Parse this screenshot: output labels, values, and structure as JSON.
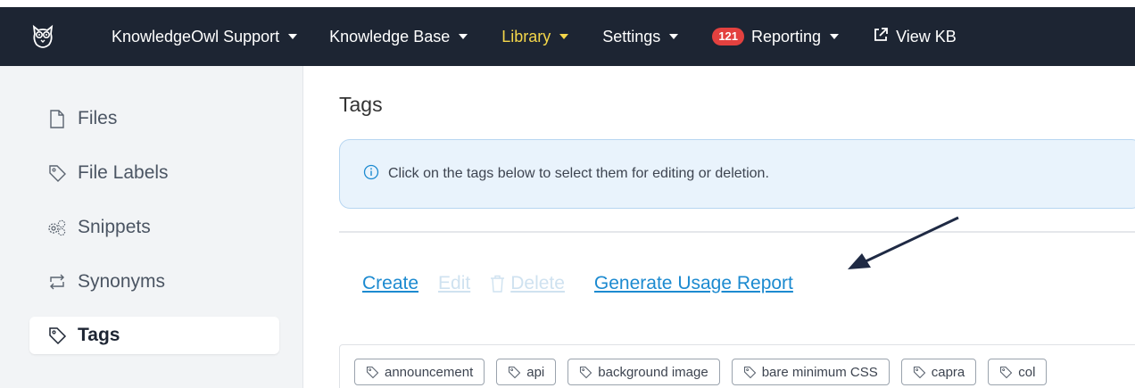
{
  "nav": {
    "logo_icon": "owl-logo-icon",
    "items": [
      {
        "label": "KnowledgeOwl Support",
        "caret": true
      },
      {
        "label": "Knowledge Base",
        "caret": true
      },
      {
        "label": "Library",
        "caret": true,
        "active": true
      },
      {
        "label": "Settings",
        "caret": true
      },
      {
        "label": "Reporting",
        "caret": true,
        "badge": "121"
      },
      {
        "label": "View KB",
        "icon": "external-link-icon"
      }
    ],
    "colors": {
      "background": "#1d2533",
      "active": "#f4d64a",
      "badge": "#e3413f"
    }
  },
  "sidebar": {
    "items": [
      {
        "label": "Files",
        "icon": "file-icon"
      },
      {
        "label": "File Labels",
        "icon": "tag-icon"
      },
      {
        "label": "Snippets",
        "icon": "gears-icon"
      },
      {
        "label": "Synonyms",
        "icon": "swap-arrows-icon"
      },
      {
        "label": "Tags",
        "icon": "tag-icon",
        "active": true
      }
    ]
  },
  "main": {
    "title": "Tags",
    "alert": {
      "icon": "info-icon",
      "text": "Click on the tags below to select them for editing or deletion."
    },
    "actions": {
      "create": "Create",
      "edit": "Edit",
      "delete": "Delete",
      "report": "Generate Usage Report"
    },
    "tags": [
      "announcement",
      "api",
      "background image",
      "bare minimum CSS",
      "capra",
      "col"
    ]
  }
}
